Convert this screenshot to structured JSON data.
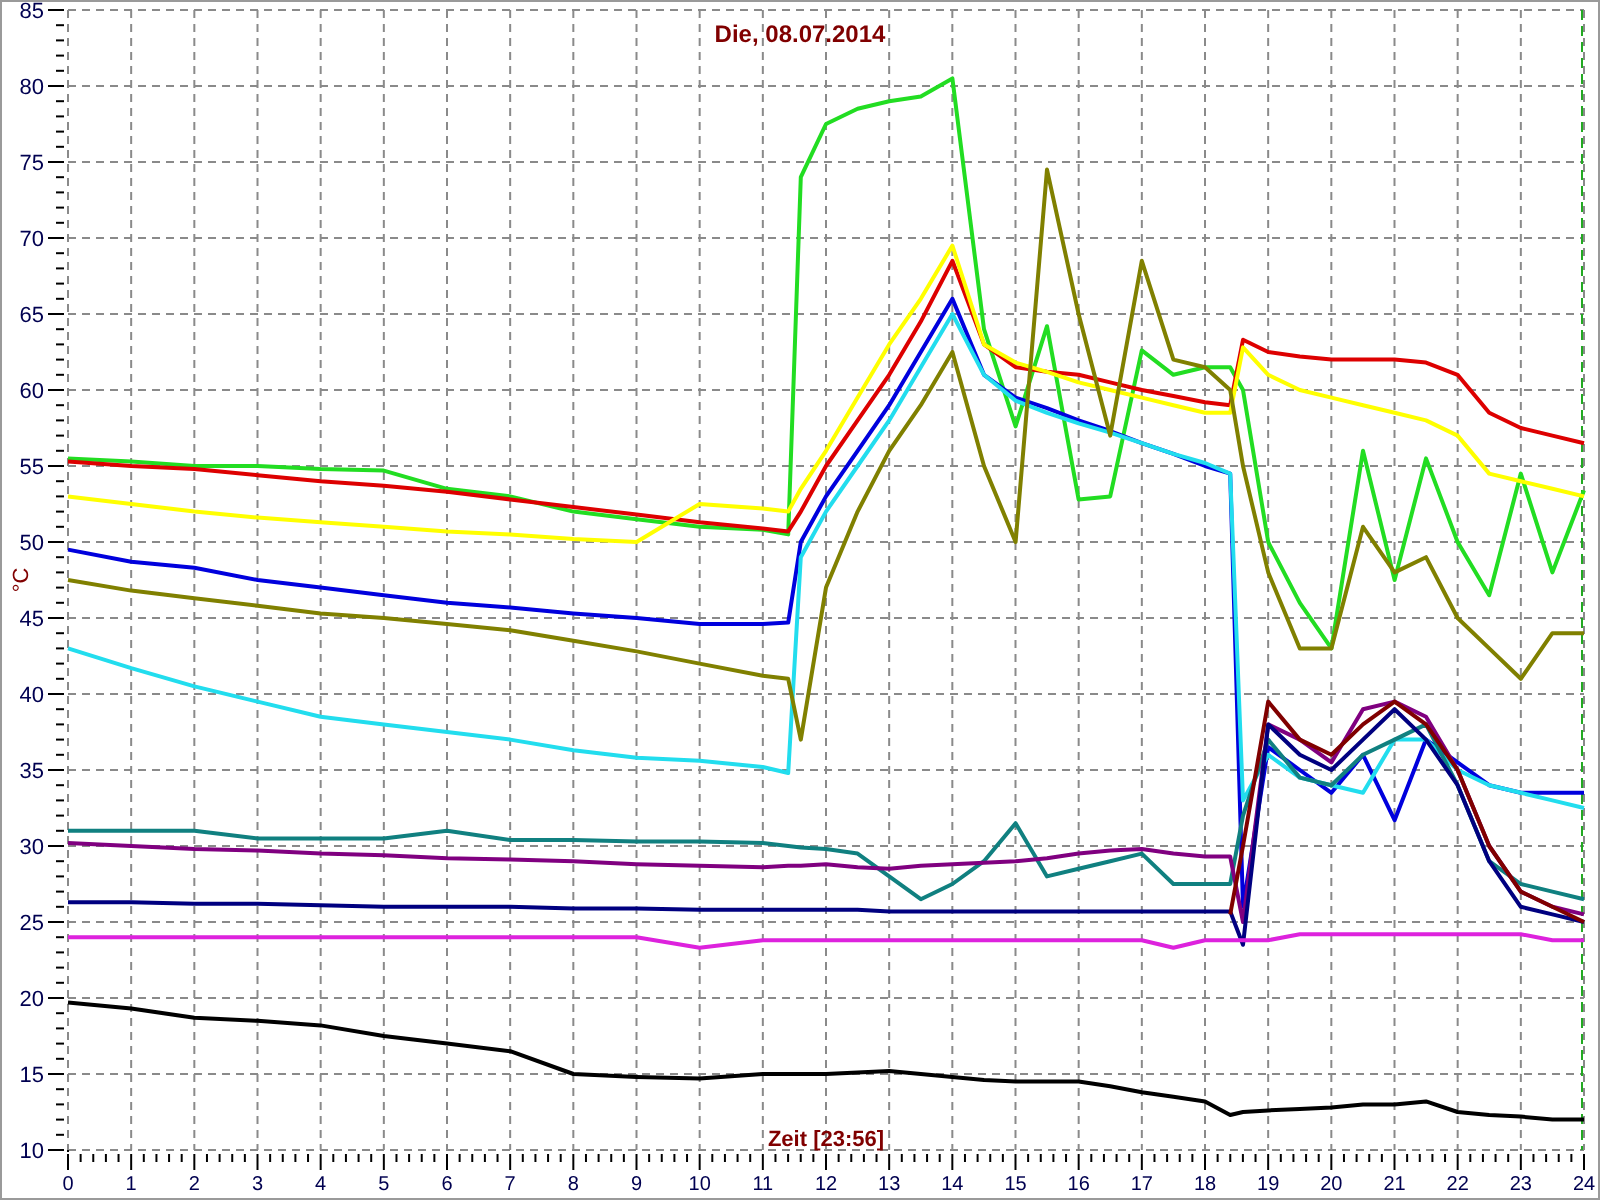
{
  "chart": {
    "chart_data": {
      "type": "line",
      "title": "Die, 08.07.2014",
      "xlabel": "Zeit [23:56]",
      "ylabel": "°C",
      "x": [
        0,
        1,
        2,
        3,
        4,
        5,
        6,
        7,
        8,
        9,
        10,
        11,
        11.4,
        11.6,
        12,
        12.5,
        13,
        13.5,
        14,
        14.5,
        15,
        15.5,
        16,
        16.5,
        17,
        17.5,
        18,
        18.4,
        18.6,
        19,
        19.5,
        20,
        20.5,
        21,
        21.5,
        22,
        22.5,
        23,
        23.5,
        24
      ],
      "series": [
        {
          "color": "#22dd22",
          "values": [
            55.5,
            55.3,
            55.0,
            55.0,
            54.8,
            54.7,
            53.5,
            53.0,
            52.0,
            51.5,
            51.0,
            50.8,
            50.5,
            74.0,
            77.5,
            78.5,
            79.0,
            79.3,
            80.5,
            64.0,
            57.6,
            64.2,
            52.8,
            53.0,
            62.6,
            61.0,
            61.5,
            61.5,
            60.0,
            50.0,
            46.0,
            43.0,
            56.0,
            47.5,
            55.5,
            50.0,
            46.5,
            54.5,
            48.0,
            53.4
          ]
        },
        {
          "color": "#dd0000",
          "values": [
            55.3,
            55.0,
            54.8,
            54.4,
            54.0,
            53.7,
            53.3,
            52.8,
            52.3,
            51.8,
            51.3,
            50.9,
            50.7,
            52.0,
            55.0,
            58.0,
            61.0,
            64.5,
            68.5,
            63.0,
            61.5,
            61.2,
            61.0,
            60.5,
            60.0,
            59.6,
            59.2,
            59.0,
            63.3,
            62.5,
            62.2,
            62.0,
            62.0,
            62.0,
            61.8,
            61.0,
            58.5,
            57.5,
            57.0,
            56.5
          ]
        },
        {
          "color": "#ffff00",
          "values": [
            53.0,
            52.5,
            52.0,
            51.6,
            51.3,
            51.0,
            50.7,
            50.5,
            50.2,
            50.0,
            52.5,
            52.2,
            52.0,
            53.5,
            56.0,
            59.5,
            63.0,
            66.0,
            69.5,
            63.0,
            61.8,
            61.2,
            60.5,
            60.0,
            59.5,
            59.0,
            58.5,
            58.5,
            62.8,
            61.0,
            60.0,
            59.5,
            59.0,
            58.5,
            58.0,
            57.0,
            54.5,
            54.0,
            53.5,
            53.0
          ]
        },
        {
          "color": "#0000dd",
          "values": [
            49.5,
            48.7,
            48.3,
            47.5,
            47.0,
            46.5,
            46.0,
            45.7,
            45.3,
            45.0,
            44.6,
            44.6,
            44.7,
            50.0,
            53.0,
            56.0,
            59.0,
            62.5,
            66.0,
            61.0,
            59.5,
            58.8,
            58.0,
            57.3,
            56.5,
            55.8,
            55.0,
            54.5,
            26.0,
            36.5,
            35.0,
            33.5,
            36.0,
            31.7,
            37.0,
            35.5,
            34.0,
            33.5,
            33.5,
            33.5
          ]
        },
        {
          "color": "#22ddee",
          "values": [
            43.0,
            41.7,
            40.5,
            39.5,
            38.5,
            38.0,
            37.5,
            37.0,
            36.3,
            35.8,
            35.6,
            35.2,
            34.8,
            49.0,
            52.0,
            55.0,
            58.0,
            61.5,
            65.0,
            61.0,
            59.3,
            58.5,
            57.8,
            57.2,
            56.5,
            55.8,
            55.2,
            54.5,
            33.0,
            36.0,
            34.5,
            34.0,
            33.5,
            37.0,
            37.0,
            35.0,
            34.0,
            33.5,
            33.0,
            32.5
          ]
        },
        {
          "color": "#808000",
          "values": [
            47.5,
            46.8,
            46.3,
            45.8,
            45.3,
            45.0,
            44.6,
            44.2,
            43.5,
            42.8,
            42.0,
            41.2,
            41.0,
            37.0,
            47.0,
            52.0,
            56.0,
            59.0,
            62.5,
            55.0,
            50.0,
            74.5,
            65.0,
            57.0,
            68.5,
            62.0,
            61.5,
            60.0,
            55.0,
            48.0,
            43.0,
            43.0,
            51.0,
            48.0,
            49.0,
            45.0,
            43.0,
            41.0,
            44.0,
            44.0
          ]
        },
        {
          "color": "#108080",
          "values": [
            31.0,
            31.0,
            31.0,
            30.5,
            30.5,
            30.5,
            31.0,
            30.4,
            30.4,
            30.3,
            30.3,
            30.2,
            30.0,
            29.9,
            29.8,
            29.5,
            28.0,
            26.5,
            27.5,
            29.0,
            31.5,
            28.0,
            28.5,
            29.0,
            29.5,
            27.5,
            27.5,
            27.5,
            32.0,
            37.0,
            34.5,
            34.0,
            36.0,
            37.0,
            38.0,
            34.0,
            29.0,
            27.5,
            27.0,
            26.5
          ]
        },
        {
          "color": "#800080",
          "values": [
            30.2,
            30.0,
            29.8,
            29.7,
            29.5,
            29.4,
            29.2,
            29.1,
            29.0,
            28.8,
            28.7,
            28.6,
            28.7,
            28.7,
            28.8,
            28.6,
            28.5,
            28.7,
            28.8,
            28.9,
            29.0,
            29.2,
            29.5,
            29.7,
            29.8,
            29.5,
            29.3,
            29.3,
            25.0,
            38.0,
            37.0,
            35.5,
            39.0,
            39.5,
            38.5,
            35.0,
            30.0,
            27.0,
            26.0,
            25.5
          ]
        },
        {
          "color": "#000080",
          "values": [
            26.3,
            26.3,
            26.2,
            26.2,
            26.1,
            26.0,
            26.0,
            26.0,
            25.9,
            25.9,
            25.8,
            25.8,
            25.8,
            25.8,
            25.8,
            25.8,
            25.7,
            25.7,
            25.7,
            25.7,
            25.7,
            25.7,
            25.7,
            25.7,
            25.7,
            25.7,
            25.7,
            25.7,
            23.5,
            38.0,
            36.0,
            35.0,
            37.0,
            39.0,
            37.0,
            34.0,
            29.0,
            26.0,
            25.5,
            25.0
          ]
        },
        {
          "color": "#800000",
          "values": [
            null,
            null,
            null,
            null,
            null,
            null,
            null,
            null,
            null,
            null,
            null,
            null,
            null,
            null,
            null,
            null,
            null,
            null,
            null,
            null,
            null,
            null,
            null,
            null,
            null,
            null,
            null,
            25.5,
            30.0,
            39.5,
            37.0,
            36.0,
            38.0,
            39.5,
            38.0,
            35.0,
            30.0,
            27.0,
            26.0,
            25.0
          ]
        },
        {
          "color": "#dd22dd",
          "values": [
            24.0,
            24.0,
            24.0,
            24.0,
            24.0,
            24.0,
            24.0,
            24.0,
            24.0,
            24.0,
            23.3,
            23.8,
            23.8,
            23.8,
            23.8,
            23.8,
            23.8,
            23.8,
            23.8,
            23.8,
            23.8,
            23.8,
            23.8,
            23.8,
            23.8,
            23.3,
            23.8,
            23.8,
            23.8,
            23.8,
            24.2,
            24.2,
            24.2,
            24.2,
            24.2,
            24.2,
            24.2,
            24.2,
            23.8,
            23.8
          ]
        },
        {
          "color": "#000000",
          "values": [
            19.7,
            19.3,
            18.7,
            18.5,
            18.2,
            17.5,
            17.0,
            16.5,
            15.0,
            14.8,
            14.7,
            15.0,
            15.0,
            15.0,
            15.0,
            15.1,
            15.2,
            15.0,
            14.8,
            14.6,
            14.5,
            14.5,
            14.5,
            14.2,
            13.8,
            13.5,
            13.2,
            12.3,
            12.5,
            12.6,
            12.7,
            12.8,
            13.0,
            13.0,
            13.2,
            12.5,
            12.3,
            12.2,
            12.0,
            12.0
          ]
        }
      ],
      "xlim": [
        0,
        24
      ],
      "ylim": [
        10,
        85
      ],
      "xticks": [
        0,
        1,
        2,
        3,
        4,
        5,
        6,
        7,
        8,
        9,
        10,
        11,
        12,
        13,
        14,
        15,
        16,
        17,
        18,
        19,
        20,
        21,
        22,
        23,
        24
      ],
      "yticks": [
        10,
        15,
        20,
        25,
        30,
        35,
        40,
        45,
        50,
        55,
        60,
        65,
        70,
        75,
        80,
        85
      ],
      "grid": true
    }
  }
}
